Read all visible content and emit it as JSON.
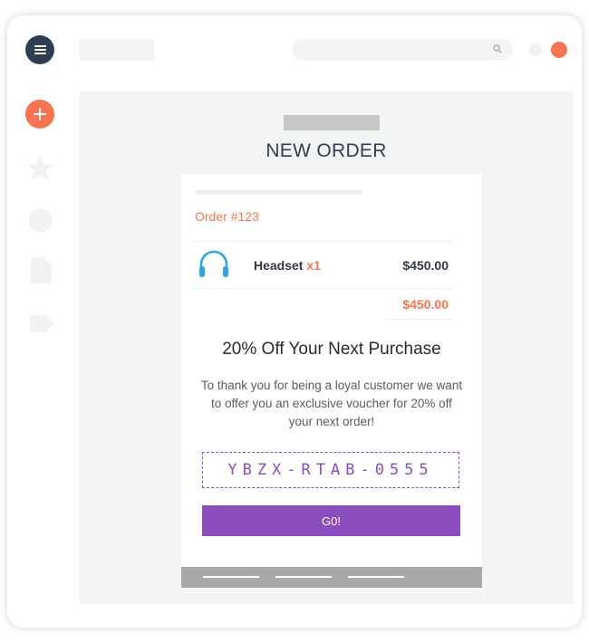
{
  "colors": {
    "accent": "#f87451",
    "navy": "#2f3e55",
    "purple": "#8b4cbd",
    "main_bg": "#f3f4f4"
  },
  "header": {
    "menu_icon": "hamburger-menu-icon",
    "search_icon": "search-icon"
  },
  "sidebar": {
    "items": [
      {
        "icon": "add-icon"
      },
      {
        "icon": "star-icon"
      },
      {
        "icon": "circle-icon"
      },
      {
        "icon": "document-icon"
      },
      {
        "icon": "tag-icon"
      }
    ]
  },
  "main": {
    "title": "NEW ORDER",
    "order": {
      "number": "Order #123",
      "item": {
        "icon": "headset-icon",
        "name": "Headset",
        "qty": "x1",
        "price": "$450.00"
      },
      "total": "$450.00"
    },
    "promo": {
      "title": "20% Off Your Next Purchase",
      "text": "To thank you for being a loyal customer we want to offer you an exclusive voucher for 20% off your next order!",
      "voucher_code": "YBZX-RTAB-0555",
      "button_label": "G0!"
    }
  }
}
